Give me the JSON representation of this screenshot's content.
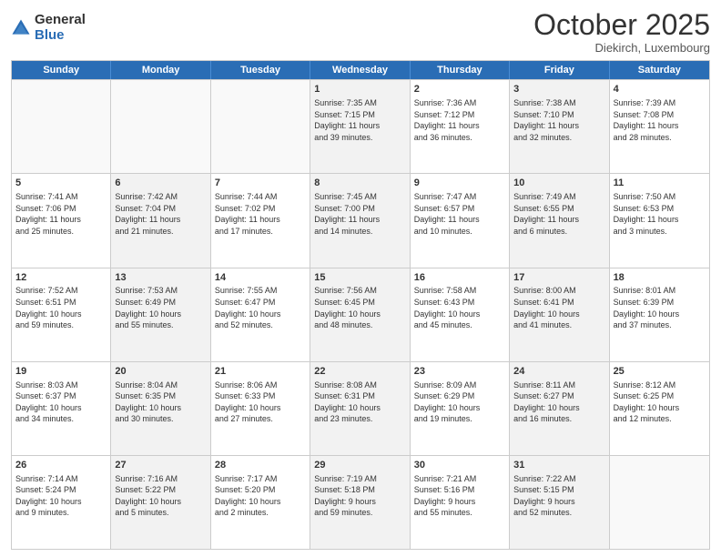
{
  "header": {
    "logo_general": "General",
    "logo_blue": "Blue",
    "month": "October 2025",
    "location": "Diekirch, Luxembourg"
  },
  "days_of_week": [
    "Sunday",
    "Monday",
    "Tuesday",
    "Wednesday",
    "Thursday",
    "Friday",
    "Saturday"
  ],
  "weeks": [
    [
      {
        "day": "",
        "info": "",
        "empty": true
      },
      {
        "day": "",
        "info": "",
        "empty": true
      },
      {
        "day": "",
        "info": "",
        "empty": true
      },
      {
        "day": "1",
        "info": "Sunrise: 7:35 AM\nSunset: 7:15 PM\nDaylight: 11 hours\nand 39 minutes.",
        "shaded": true
      },
      {
        "day": "2",
        "info": "Sunrise: 7:36 AM\nSunset: 7:12 PM\nDaylight: 11 hours\nand 36 minutes.",
        "shaded": false
      },
      {
        "day": "3",
        "info": "Sunrise: 7:38 AM\nSunset: 7:10 PM\nDaylight: 11 hours\nand 32 minutes.",
        "shaded": true
      },
      {
        "day": "4",
        "info": "Sunrise: 7:39 AM\nSunset: 7:08 PM\nDaylight: 11 hours\nand 28 minutes.",
        "shaded": false
      }
    ],
    [
      {
        "day": "5",
        "info": "Sunrise: 7:41 AM\nSunset: 7:06 PM\nDaylight: 11 hours\nand 25 minutes.",
        "shaded": false
      },
      {
        "day": "6",
        "info": "Sunrise: 7:42 AM\nSunset: 7:04 PM\nDaylight: 11 hours\nand 21 minutes.",
        "shaded": true
      },
      {
        "day": "7",
        "info": "Sunrise: 7:44 AM\nSunset: 7:02 PM\nDaylight: 11 hours\nand 17 minutes.",
        "shaded": false
      },
      {
        "day": "8",
        "info": "Sunrise: 7:45 AM\nSunset: 7:00 PM\nDaylight: 11 hours\nand 14 minutes.",
        "shaded": true
      },
      {
        "day": "9",
        "info": "Sunrise: 7:47 AM\nSunset: 6:57 PM\nDaylight: 11 hours\nand 10 minutes.",
        "shaded": false
      },
      {
        "day": "10",
        "info": "Sunrise: 7:49 AM\nSunset: 6:55 PM\nDaylight: 11 hours\nand 6 minutes.",
        "shaded": true
      },
      {
        "day": "11",
        "info": "Sunrise: 7:50 AM\nSunset: 6:53 PM\nDaylight: 11 hours\nand 3 minutes.",
        "shaded": false
      }
    ],
    [
      {
        "day": "12",
        "info": "Sunrise: 7:52 AM\nSunset: 6:51 PM\nDaylight: 10 hours\nand 59 minutes.",
        "shaded": false
      },
      {
        "day": "13",
        "info": "Sunrise: 7:53 AM\nSunset: 6:49 PM\nDaylight: 10 hours\nand 55 minutes.",
        "shaded": true
      },
      {
        "day": "14",
        "info": "Sunrise: 7:55 AM\nSunset: 6:47 PM\nDaylight: 10 hours\nand 52 minutes.",
        "shaded": false
      },
      {
        "day": "15",
        "info": "Sunrise: 7:56 AM\nSunset: 6:45 PM\nDaylight: 10 hours\nand 48 minutes.",
        "shaded": true
      },
      {
        "day": "16",
        "info": "Sunrise: 7:58 AM\nSunset: 6:43 PM\nDaylight: 10 hours\nand 45 minutes.",
        "shaded": false
      },
      {
        "day": "17",
        "info": "Sunrise: 8:00 AM\nSunset: 6:41 PM\nDaylight: 10 hours\nand 41 minutes.",
        "shaded": true
      },
      {
        "day": "18",
        "info": "Sunrise: 8:01 AM\nSunset: 6:39 PM\nDaylight: 10 hours\nand 37 minutes.",
        "shaded": false
      }
    ],
    [
      {
        "day": "19",
        "info": "Sunrise: 8:03 AM\nSunset: 6:37 PM\nDaylight: 10 hours\nand 34 minutes.",
        "shaded": false
      },
      {
        "day": "20",
        "info": "Sunrise: 8:04 AM\nSunset: 6:35 PM\nDaylight: 10 hours\nand 30 minutes.",
        "shaded": true
      },
      {
        "day": "21",
        "info": "Sunrise: 8:06 AM\nSunset: 6:33 PM\nDaylight: 10 hours\nand 27 minutes.",
        "shaded": false
      },
      {
        "day": "22",
        "info": "Sunrise: 8:08 AM\nSunset: 6:31 PM\nDaylight: 10 hours\nand 23 minutes.",
        "shaded": true
      },
      {
        "day": "23",
        "info": "Sunrise: 8:09 AM\nSunset: 6:29 PM\nDaylight: 10 hours\nand 19 minutes.",
        "shaded": false
      },
      {
        "day": "24",
        "info": "Sunrise: 8:11 AM\nSunset: 6:27 PM\nDaylight: 10 hours\nand 16 minutes.",
        "shaded": true
      },
      {
        "day": "25",
        "info": "Sunrise: 8:12 AM\nSunset: 6:25 PM\nDaylight: 10 hours\nand 12 minutes.",
        "shaded": false
      }
    ],
    [
      {
        "day": "26",
        "info": "Sunrise: 7:14 AM\nSunset: 5:24 PM\nDaylight: 10 hours\nand 9 minutes.",
        "shaded": false
      },
      {
        "day": "27",
        "info": "Sunrise: 7:16 AM\nSunset: 5:22 PM\nDaylight: 10 hours\nand 5 minutes.",
        "shaded": true
      },
      {
        "day": "28",
        "info": "Sunrise: 7:17 AM\nSunset: 5:20 PM\nDaylight: 10 hours\nand 2 minutes.",
        "shaded": false
      },
      {
        "day": "29",
        "info": "Sunrise: 7:19 AM\nSunset: 5:18 PM\nDaylight: 9 hours\nand 59 minutes.",
        "shaded": true
      },
      {
        "day": "30",
        "info": "Sunrise: 7:21 AM\nSunset: 5:16 PM\nDaylight: 9 hours\nand 55 minutes.",
        "shaded": false
      },
      {
        "day": "31",
        "info": "Sunrise: 7:22 AM\nSunset: 5:15 PM\nDaylight: 9 hours\nand 52 minutes.",
        "shaded": true
      },
      {
        "day": "",
        "info": "",
        "empty": true
      }
    ]
  ]
}
